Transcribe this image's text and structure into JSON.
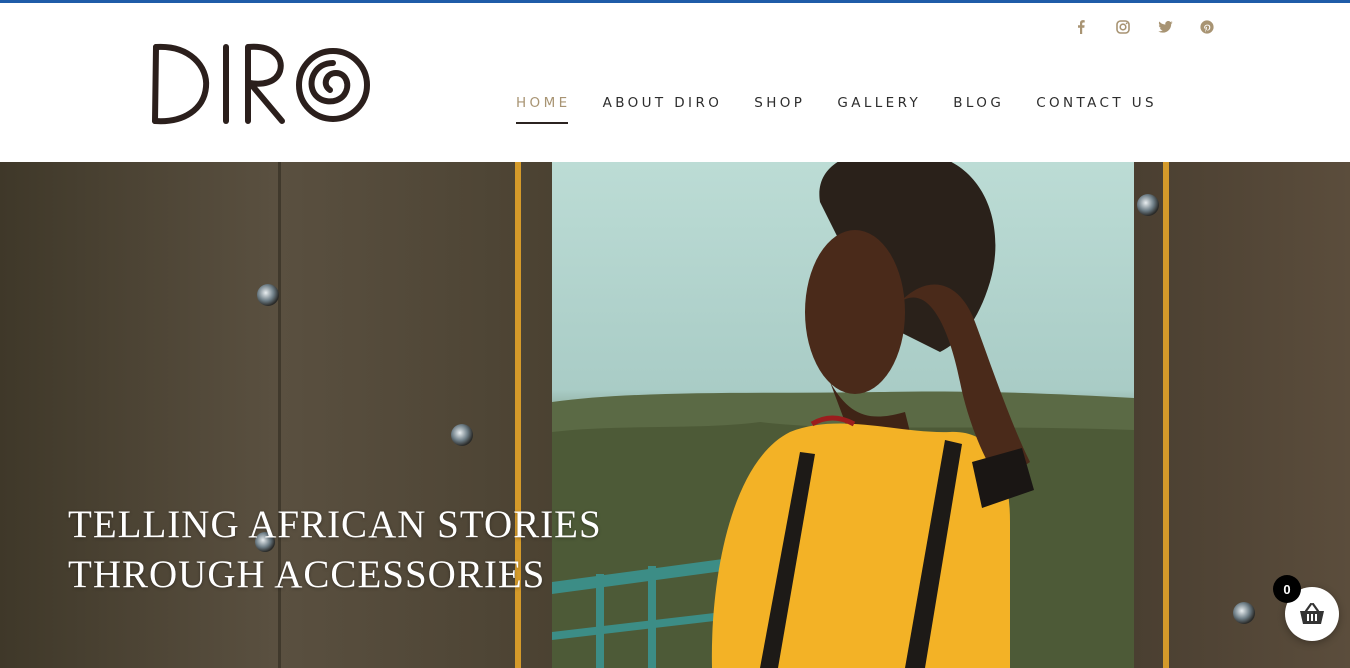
{
  "brand": {
    "logo_text": "DIRO"
  },
  "colors": {
    "top_accent": "#1f5ca8",
    "nav_active": "#a89473",
    "social_icon": "#a89473",
    "nav_text": "#2d2d2d"
  },
  "social": [
    {
      "icon": "facebook-icon"
    },
    {
      "icon": "instagram-icon"
    },
    {
      "icon": "twitter-icon"
    },
    {
      "icon": "pinterest-icon"
    }
  ],
  "nav": {
    "items": [
      {
        "label": "HOME",
        "active": true
      },
      {
        "label": "ABOUT DIRO"
      },
      {
        "label": "SHOP"
      },
      {
        "label": "GALLERY"
      },
      {
        "label": "BLOG"
      },
      {
        "label": "CONTACT US"
      }
    ]
  },
  "hero": {
    "line1": "TELLING AFRICAN STORIES",
    "line2": "THROUGH ACCESSORIES"
  },
  "cart": {
    "count": "0",
    "icon": "basket-icon"
  }
}
